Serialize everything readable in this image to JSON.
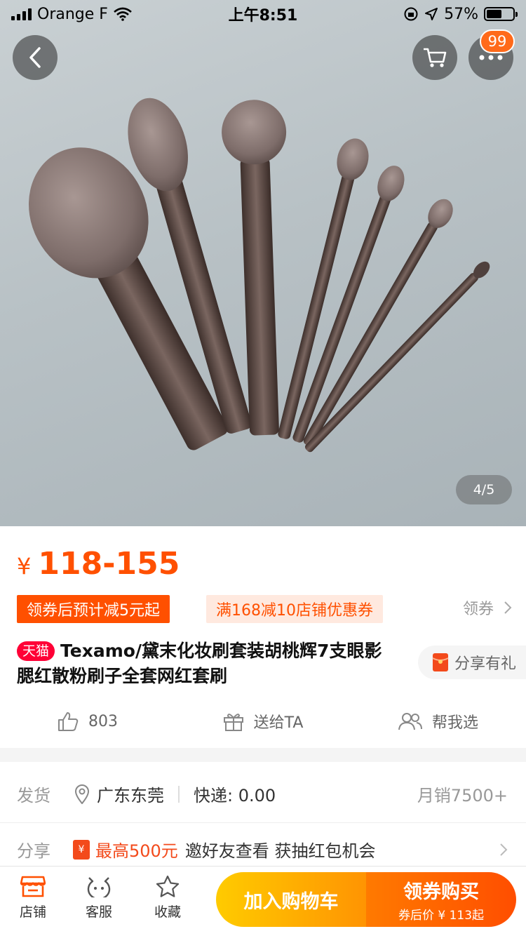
{
  "status_bar": {
    "carrier": "Orange F",
    "time": "上午8:51",
    "battery_percent": "57%",
    "battery_level": 0.57
  },
  "hero": {
    "pager": "4/5",
    "cart_badge": "99"
  },
  "product": {
    "currency": "¥",
    "price_range": "118-155",
    "coupon_primary": "领券后预计减5元起",
    "coupon_store": "满168减10店铺优惠券",
    "get_coupon": "领券",
    "tmall_tag": "天猫",
    "title": "Texamo/黛末化妆刷套装胡桃辉7支眼影腮红散粉刷子全套网红套刷",
    "share_gift": "分享有礼"
  },
  "actions": {
    "like_count": "803",
    "gift_label": "送给TA",
    "help_label": "帮我选"
  },
  "shipping": {
    "label": "发货",
    "location": "广东东莞",
    "express": "快递: 0.00",
    "monthly_sales": "月销7500+"
  },
  "share_row": {
    "label": "分享",
    "redbag_glyph": "¥",
    "max_reward": "最高500元",
    "desc": "邀好友查看 获抽红包机会"
  },
  "bottom_bar": {
    "shop": "店铺",
    "service": "客服",
    "favorite": "收藏",
    "add_to_cart": "加入购物车",
    "buy_main": "领券购买",
    "buy_sub": "券后价 ¥ 113起"
  },
  "colors": {
    "brand_orange": "#ff5000",
    "tmall_red": "#ff0036",
    "cart_yellow": "#ffcb00"
  }
}
